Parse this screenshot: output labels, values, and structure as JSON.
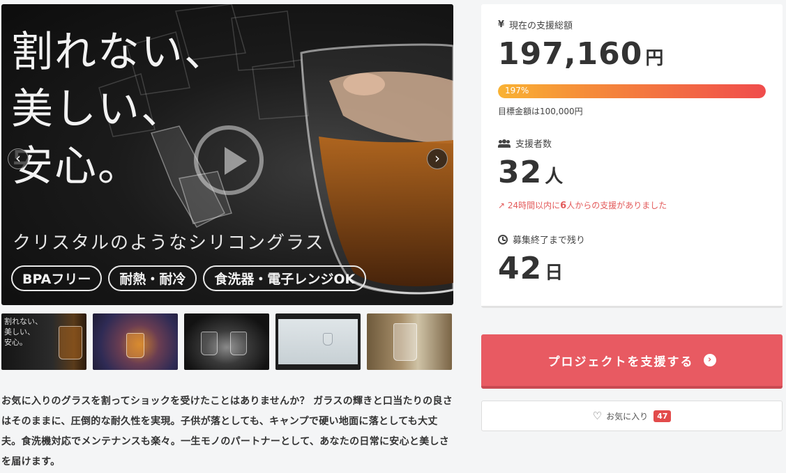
{
  "hero": {
    "headline": "割れない、\n美しい、\n安心。",
    "subline": "クリスタルのようなシリコングラス",
    "pills": [
      "BPAフリー",
      "耐熱・耐冷",
      "食洗器・電子レンジOK"
    ],
    "prev_label": "‹",
    "next_label": "›"
  },
  "thumbnails": {
    "first_caption": "割れない、\n美しい、\n安心。"
  },
  "description": "お気に入りのグラスを割ってショックを受けたことはありませんか？ ガラスの輝きと口当たりの良さはそのままに、圧倒的な耐久性を実現。子供が落としても、キャンプで硬い地面に落としても大丈夫。食洗機対応でメンテナンスも楽々。一生モノのパートナーとして、あなたの日常に安心と美しさを届けます。",
  "stats": {
    "total": {
      "icon": "yen-icon",
      "label": "現在の支援総額",
      "value": "197,160",
      "unit": "円",
      "progress_percent": 197,
      "progress_label": "197%",
      "goal": "目標金額は100,000円"
    },
    "backers": {
      "icon": "users-icon",
      "label": "支援者数",
      "value": "32",
      "unit": "人",
      "trend_prefix": "24時間以内に",
      "trend_count": "6",
      "trend_suffix": "人からの支援がありました"
    },
    "remaining": {
      "icon": "clock-icon",
      "label": "募集終了まで残り",
      "value": "42",
      "unit": "日"
    }
  },
  "actions": {
    "support_label": "プロジェクトを支援する",
    "support_arrow": "›",
    "favorite_label": "お気に入り",
    "favorite_count": "47"
  },
  "colors": {
    "accent": "#e85a62",
    "progress_start": "#f9b233",
    "progress_end": "#f04c4c",
    "trend": "#e35b5b",
    "badge": "#e24b4b"
  }
}
